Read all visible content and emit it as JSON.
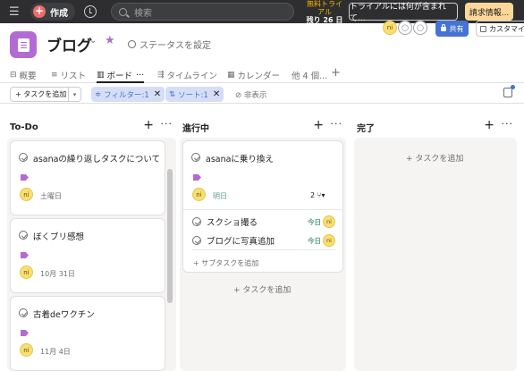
{
  "topbar": {
    "create_label": "作成",
    "search_placeholder": "検索",
    "trial_line1": "無料トライ",
    "trial_line2": "アル",
    "trial_days": "残り 26 日",
    "whats_in_trial": "トライアルには何が含まれて...",
    "billing": "請求情報..."
  },
  "project": {
    "title": "ブログ",
    "status": "ステータスを設定",
    "avatars": [
      "ni",
      "",
      ""
    ],
    "share": "共有",
    "customize": "カスタマイ"
  },
  "tabs": [
    {
      "icon": "概",
      "label": "概要"
    },
    {
      "icon": "≡",
      "label": "リスト"
    },
    {
      "icon": "▥",
      "label": "ボード",
      "suffix": "···"
    },
    {
      "icon": "⇶",
      "label": "タイムライン"
    },
    {
      "icon": "▦",
      "label": "カレンダー"
    },
    {
      "icon": "",
      "label": "他 4 個..."
    }
  ],
  "toolbar": {
    "add_task": "+ タスクを追加",
    "filter": "フィルター:1",
    "sort": "ソート:1",
    "hide": "非表示"
  },
  "columns": [
    {
      "name": "To-Do",
      "cards": [
        {
          "title": "asanaの繰り返しタスクについて",
          "date": "土曜日",
          "assignee": "ni"
        },
        {
          "title": "ぼくブリ感想",
          "date": "10月 31日",
          "assignee": "ni"
        },
        {
          "title": "古着deワクチン",
          "date": "11月 4日",
          "assignee": "ni"
        }
      ]
    },
    {
      "name": "進行中",
      "cards": [
        {
          "title": "asanaに乗り換え",
          "date": "明日",
          "assignee": "ni",
          "subtask_count": "2",
          "subtasks": [
            {
              "title": "スクショ撮る",
              "due": "今日",
              "assignee": "ni"
            },
            {
              "title": "ブログに写真追加",
              "due": "今日",
              "assignee": "ni"
            }
          ],
          "add_subtask": "+ サブタスクを追加"
        }
      ],
      "add_task": "+ タスクを追加"
    },
    {
      "name": "完了",
      "cards": [],
      "add_task": "+ タスクを追加"
    }
  ],
  "colors": {
    "topbar": "#2e2e30",
    "accent_pink": "#f06a6a",
    "project_purple": "#b36bd4",
    "share_blue": "#4573d2",
    "avatar_yellow": "#f8df72",
    "today_green": "#58a182"
  }
}
